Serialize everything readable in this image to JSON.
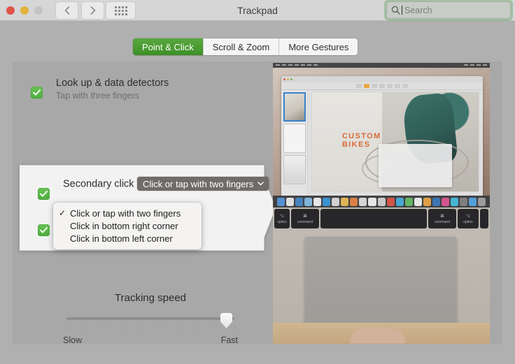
{
  "window": {
    "title": "Trackpad",
    "traffic_lights": [
      "close",
      "minimize",
      "zoom"
    ],
    "back_label": "‹",
    "forward_label": "›",
    "grid_label": "show-all"
  },
  "search": {
    "placeholder": "Search",
    "value": "",
    "focus_ring_color": "#78af78"
  },
  "tabs": [
    {
      "label": "Point & Click",
      "active": true
    },
    {
      "label": "Scroll & Zoom",
      "active": false
    },
    {
      "label": "More Gestures",
      "active": false
    }
  ],
  "settings": {
    "lookup": {
      "title": "Look up & data detectors",
      "subtitle": "Tap with three fingers",
      "checked": true
    },
    "secondary_click": {
      "title": "Secondary click",
      "checked": true,
      "selected_option": "Click or tap with two fingers",
      "options": [
        {
          "label": "Click or tap with two fingers",
          "checked": true
        },
        {
          "label": "Click in bottom right corner",
          "checked": false
        },
        {
          "label": "Click in bottom left corner",
          "checked": false
        }
      ]
    },
    "third_row": {
      "checked": true
    }
  },
  "tracking_speed": {
    "title": "Tracking speed",
    "min_label": "Slow",
    "max_label": "Fast",
    "value_percent": 95,
    "tick_count": 10
  },
  "colors": {
    "accent_green": "#4fae3e",
    "tab_active_green": "#3e8f28",
    "popup_gray": "#6f6c69",
    "panel_gray": "#a8a8a8",
    "titlebar_gray": "#d6d6d6"
  },
  "video_preview": {
    "document_headline_line1": "CUSTOM",
    "document_headline_line2": "BIKES",
    "keys": [
      "option",
      "command",
      "",
      "command",
      "option"
    ],
    "key_symbols": [
      "⌥",
      "⌘",
      "",
      "⌘",
      "⌥"
    ]
  }
}
